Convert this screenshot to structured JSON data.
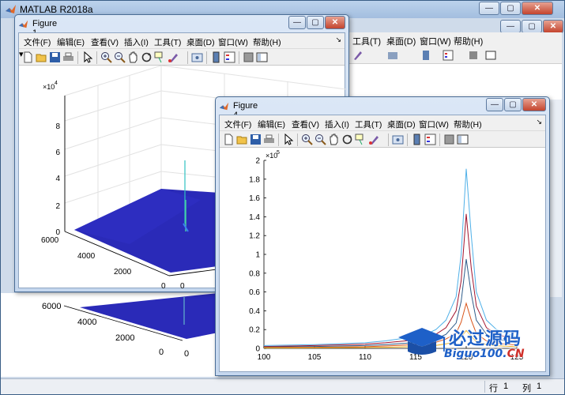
{
  "app": {
    "title": "MATLAB R2018a"
  },
  "status": {
    "row_label": "行",
    "row_value": "1",
    "col_label": "列",
    "col_value": "1"
  },
  "menu": [
    "文件(F)",
    "编辑(E)",
    "查看(V)",
    "插入(I)",
    "工具(T)",
    "桌面(D)",
    "窗口(W)",
    "帮助(H)"
  ],
  "bg_menu": [
    "工具(T)",
    "桌面(D)",
    "窗口(W)",
    "帮助(H)"
  ],
  "figure1": {
    "title": "Figure 1",
    "plot": {
      "type": "surface",
      "z_exponent_label": "×10",
      "z_exponent": "4",
      "z_ticks": [
        "0",
        "2",
        "4",
        "6",
        "8"
      ],
      "y_ticks": [
        "0",
        "2000",
        "4000",
        "6000"
      ],
      "x_ticks": [
        "0"
      ],
      "surface_color": "#2a2ab8",
      "peak_color": "#2fc0c0"
    }
  },
  "figure4": {
    "title": "Figure 4",
    "chart_data": {
      "type": "line",
      "y_exponent_label": "×10",
      "y_exponent": "5",
      "xlim": [
        100,
        125
      ],
      "ylim": [
        0,
        2
      ],
      "x_ticks": [
        "100",
        "105",
        "110",
        "115",
        "120",
        "125"
      ],
      "y_ticks": [
        "0",
        "0.2",
        "0.4",
        "0.6",
        "0.8",
        "1",
        "1.2",
        "1.4",
        "1.6",
        "1.8",
        "2"
      ],
      "x": [
        100,
        105,
        110,
        112,
        114,
        116,
        117,
        118,
        119,
        119.5,
        120,
        120.5,
        121,
        122,
        123,
        125
      ],
      "series": [
        {
          "color": "#4fb0e8",
          "values": [
            0.03,
            0.04,
            0.06,
            0.08,
            0.11,
            0.15,
            0.2,
            0.3,
            0.55,
            1.0,
            1.91,
            1.2,
            0.6,
            0.3,
            0.2,
            0.12
          ]
        },
        {
          "color": "#a2142f",
          "values": [
            0.02,
            0.03,
            0.045,
            0.06,
            0.08,
            0.11,
            0.15,
            0.22,
            0.4,
            0.72,
            1.43,
            0.85,
            0.45,
            0.22,
            0.15,
            0.09
          ]
        },
        {
          "color": "#2e5c8a",
          "values": [
            0.015,
            0.02,
            0.03,
            0.04,
            0.055,
            0.075,
            0.1,
            0.15,
            0.27,
            0.5,
            0.95,
            0.58,
            0.3,
            0.15,
            0.1,
            0.06
          ]
        },
        {
          "color": "#d9541a",
          "values": [
            0.01,
            0.012,
            0.018,
            0.025,
            0.035,
            0.05,
            0.065,
            0.1,
            0.16,
            0.28,
            0.48,
            0.3,
            0.16,
            0.08,
            0.055,
            0.035
          ]
        },
        {
          "color": "#edb120",
          "values": [
            0.005,
            0.006,
            0.009,
            0.012,
            0.017,
            0.024,
            0.032,
            0.048,
            0.075,
            0.12,
            0.19,
            0.13,
            0.07,
            0.04,
            0.028,
            0.018
          ]
        }
      ]
    }
  },
  "figure_lower": {
    "y_ticks": [
      "0",
      "2000",
      "4000",
      "6000"
    ],
    "x_ticks": [
      "0"
    ]
  },
  "watermark": {
    "cn": "必过源码",
    "url_main": "Biguo100.",
    "url_tld": "CN"
  }
}
